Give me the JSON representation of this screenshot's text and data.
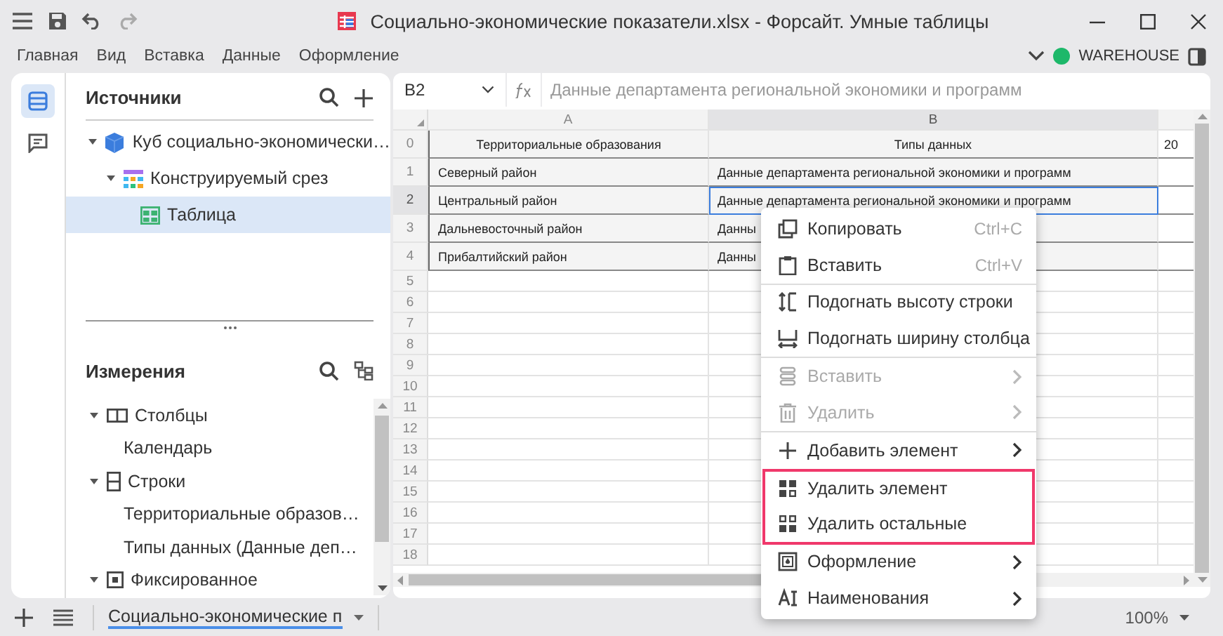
{
  "window": {
    "title": "Социально-экономические показатели.xlsx - Форсайт. Умные таблицы"
  },
  "menu": [
    {
      "label": "Главная"
    },
    {
      "label": "Вид"
    },
    {
      "label": "Вставка"
    },
    {
      "label": "Данные"
    },
    {
      "label": "Оформление"
    }
  ],
  "connection": {
    "name": "WAREHOUSE",
    "color": "#1db86a"
  },
  "rail": [
    {
      "kind": "sources",
      "selected": true
    },
    {
      "kind": "comments",
      "selected": false
    }
  ],
  "sources": {
    "title": "Источники",
    "tree": [
      {
        "label": "Куб социально-экономически…",
        "kind": "cube",
        "expanded": true,
        "selected": false,
        "children": [
          {
            "label": "Конструируемый срез",
            "kind": "slice",
            "expanded": true,
            "selected": false,
            "children": [
              {
                "label": "Таблица",
                "kind": "table",
                "selected": true
              }
            ]
          }
        ]
      }
    ]
  },
  "dimensions": {
    "title": "Измерения",
    "tree": [
      {
        "label": "Столбцы",
        "kind": "columns",
        "expanded": true,
        "children": [
          {
            "label": "Календарь"
          }
        ]
      },
      {
        "label": "Строки",
        "kind": "rows",
        "expanded": true,
        "children": [
          {
            "label": "Территориальные образов…"
          },
          {
            "label": "Типы данных (Данные деп…"
          }
        ]
      },
      {
        "label": "Фиксированное",
        "kind": "fixed",
        "expanded": true
      }
    ]
  },
  "formula_bar": {
    "cell": "B2",
    "formula": "Данные департамента региональной экономики и программ"
  },
  "sheet": {
    "columns": [
      {
        "label": "A",
        "selected": false
      },
      {
        "label": "B",
        "selected": true
      }
    ],
    "rows": [
      {
        "number": "0",
        "kind": "header",
        "selected": false,
        "cells": [
          {
            "text": "Территориальные образования",
            "selected": false
          },
          {
            "text": "Типы данных",
            "selected": false
          },
          {
            "text": "20",
            "selected": false
          }
        ]
      },
      {
        "number": "1",
        "kind": "data",
        "selected": false,
        "cells": [
          {
            "text": "Северный район",
            "selected": false
          },
          {
            "text": "Данные департамента региональной экономики и программ",
            "selected": false
          }
        ]
      },
      {
        "number": "2",
        "kind": "data",
        "selected": true,
        "cells": [
          {
            "text": "Центральный район",
            "selected": false
          },
          {
            "text": "Данные департамента региональной экономики и программ",
            "selected": true
          }
        ]
      },
      {
        "number": "3",
        "kind": "data",
        "selected": false,
        "cells": [
          {
            "text": "Дальневосточный район",
            "selected": false
          },
          {
            "text": "Данны",
            "selected": false
          }
        ]
      },
      {
        "number": "4",
        "kind": "data",
        "selected": false,
        "cells": [
          {
            "text": "Прибалтийский район",
            "selected": false
          },
          {
            "text": "Данны",
            "selected": false
          }
        ]
      },
      {
        "number": "5",
        "kind": "empty",
        "selected": false
      },
      {
        "number": "6",
        "kind": "empty",
        "selected": false
      },
      {
        "number": "7",
        "kind": "empty",
        "selected": false
      },
      {
        "number": "8",
        "kind": "empty",
        "selected": false
      },
      {
        "number": "9",
        "kind": "empty",
        "selected": false
      },
      {
        "number": "10",
        "kind": "empty",
        "selected": false
      },
      {
        "number": "11",
        "kind": "empty",
        "selected": false
      },
      {
        "number": "12",
        "kind": "empty",
        "selected": false
      },
      {
        "number": "13",
        "kind": "empty",
        "selected": false
      },
      {
        "number": "14",
        "kind": "empty",
        "selected": false
      },
      {
        "number": "15",
        "kind": "empty",
        "selected": false
      },
      {
        "number": "16",
        "kind": "empty",
        "selected": false
      },
      {
        "number": "17",
        "kind": "empty",
        "selected": false
      },
      {
        "number": "18",
        "kind": "empty",
        "selected": false
      }
    ]
  },
  "context_menu": {
    "sections": [
      {
        "highlighted": false,
        "items": [
          {
            "label": "Копировать",
            "kind": "copy",
            "shortcut": "Ctrl+C",
            "disabled": false,
            "submenu": false
          },
          {
            "label": "Вставить",
            "kind": "paste",
            "shortcut": "Ctrl+V",
            "disabled": false,
            "submenu": false
          }
        ]
      },
      {
        "highlighted": false,
        "items": [
          {
            "label": "Подогнать высоту строки",
            "kind": "fit-height",
            "disabled": false,
            "submenu": false
          },
          {
            "label": "Подогнать ширину столбца",
            "kind": "fit-width",
            "disabled": false,
            "submenu": false
          }
        ]
      },
      {
        "highlighted": false,
        "items": [
          {
            "label": "Вставить",
            "kind": "insert",
            "disabled": true,
            "submenu": true
          },
          {
            "label": "Удалить",
            "kind": "delete",
            "disabled": true,
            "submenu": true
          }
        ]
      },
      {
        "highlighted": false,
        "items": [
          {
            "label": "Добавить элемент",
            "kind": "add",
            "disabled": false,
            "submenu": true
          }
        ]
      },
      {
        "highlighted": true,
        "items": [
          {
            "label": "Удалить элемент",
            "kind": "remove-element",
            "disabled": false,
            "submenu": false
          },
          {
            "label": "Удалить остальные",
            "kind": "remove-others",
            "disabled": false,
            "submenu": false
          }
        ]
      },
      {
        "highlighted": false,
        "items": [
          {
            "label": "Оформление",
            "kind": "format",
            "disabled": false,
            "submenu": true
          },
          {
            "label": "Наименования",
            "kind": "names",
            "disabled": false,
            "submenu": true
          }
        ]
      }
    ]
  },
  "bottom_bar": {
    "sheet_tab": {
      "label": "Социально-экономические п",
      "selected": true
    },
    "zoom": "100%"
  }
}
